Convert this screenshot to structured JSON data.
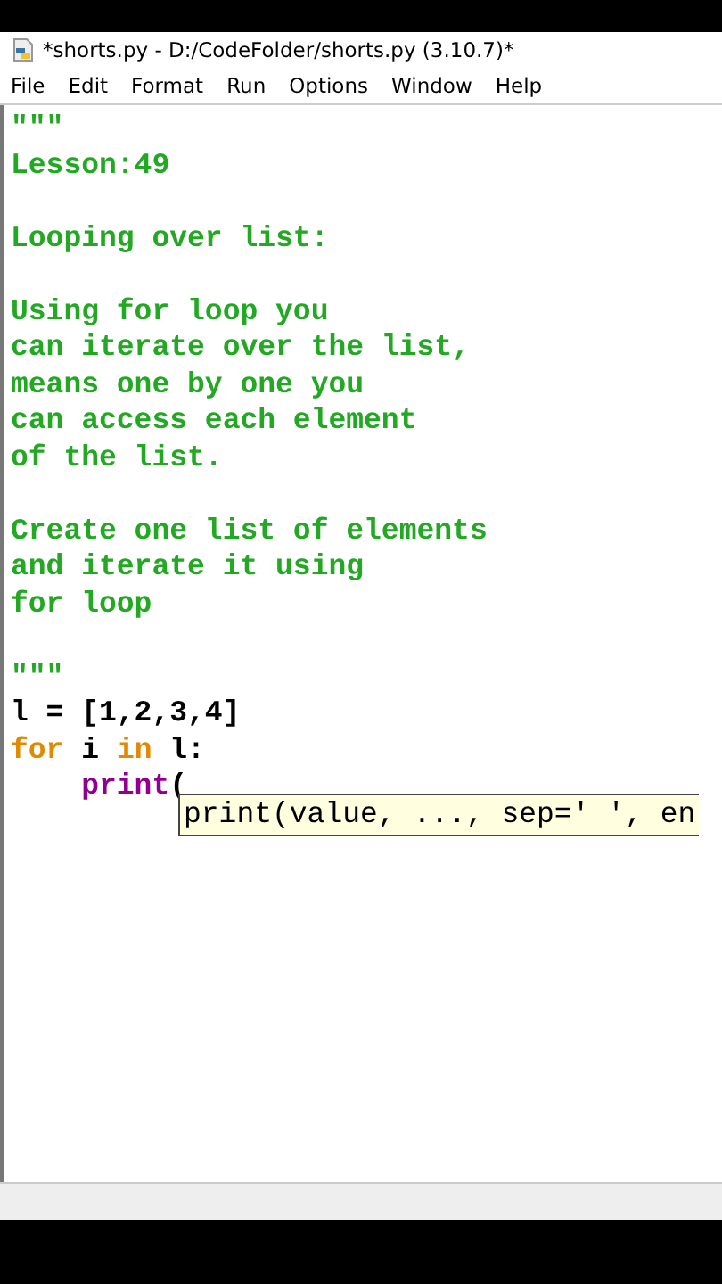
{
  "window": {
    "title": "*shorts.py - D:/CodeFolder/shorts.py (3.10.7)*"
  },
  "menu": [
    "File",
    "Edit",
    "Format",
    "Run",
    "Options",
    "Window",
    "Help"
  ],
  "editor": {
    "lines": [
      {
        "kind": "code",
        "tokens": [
          {
            "text": "\"\"\"",
            "kind": "string"
          }
        ]
      },
      {
        "kind": "code",
        "tokens": [
          {
            "text": "Lesson:49",
            "kind": "string"
          }
        ]
      },
      {
        "kind": "blank"
      },
      {
        "kind": "code",
        "tokens": [
          {
            "text": "Looping over list:",
            "kind": "string"
          }
        ]
      },
      {
        "kind": "blank"
      },
      {
        "kind": "code",
        "tokens": [
          {
            "text": "Using for loop you",
            "kind": "string"
          }
        ]
      },
      {
        "kind": "code",
        "tokens": [
          {
            "text": "can iterate over the list,",
            "kind": "string"
          }
        ]
      },
      {
        "kind": "code",
        "tokens": [
          {
            "text": "means one by one you",
            "kind": "string"
          }
        ]
      },
      {
        "kind": "code",
        "tokens": [
          {
            "text": "can access each element",
            "kind": "string"
          }
        ]
      },
      {
        "kind": "code",
        "tokens": [
          {
            "text": "of the list.",
            "kind": "string"
          }
        ]
      },
      {
        "kind": "blank"
      },
      {
        "kind": "code",
        "tokens": [
          {
            "text": "Create one list of elements",
            "kind": "string"
          }
        ]
      },
      {
        "kind": "code",
        "tokens": [
          {
            "text": "and iterate it using",
            "kind": "string"
          }
        ]
      },
      {
        "kind": "code",
        "tokens": [
          {
            "text": "for loop",
            "kind": "string"
          }
        ]
      },
      {
        "kind": "blank"
      },
      {
        "kind": "code",
        "tokens": [
          {
            "text": "\"\"\"",
            "kind": "string"
          }
        ]
      },
      {
        "kind": "code",
        "tokens": [
          {
            "text": "l = [1,2,3,4]",
            "kind": "plain"
          }
        ]
      },
      {
        "kind": "code",
        "tokens": [
          {
            "text": "for",
            "kind": "keyword"
          },
          {
            "text": " i ",
            "kind": "plain"
          },
          {
            "text": "in",
            "kind": "keyword"
          },
          {
            "text": " l:",
            "kind": "plain"
          }
        ]
      },
      {
        "kind": "indented",
        "tokens": [
          {
            "text": "print",
            "kind": "builtin"
          },
          {
            "text": "(",
            "kind": "plain"
          }
        ]
      }
    ],
    "calltip": "print(value, ..., sep=' ', en"
  }
}
